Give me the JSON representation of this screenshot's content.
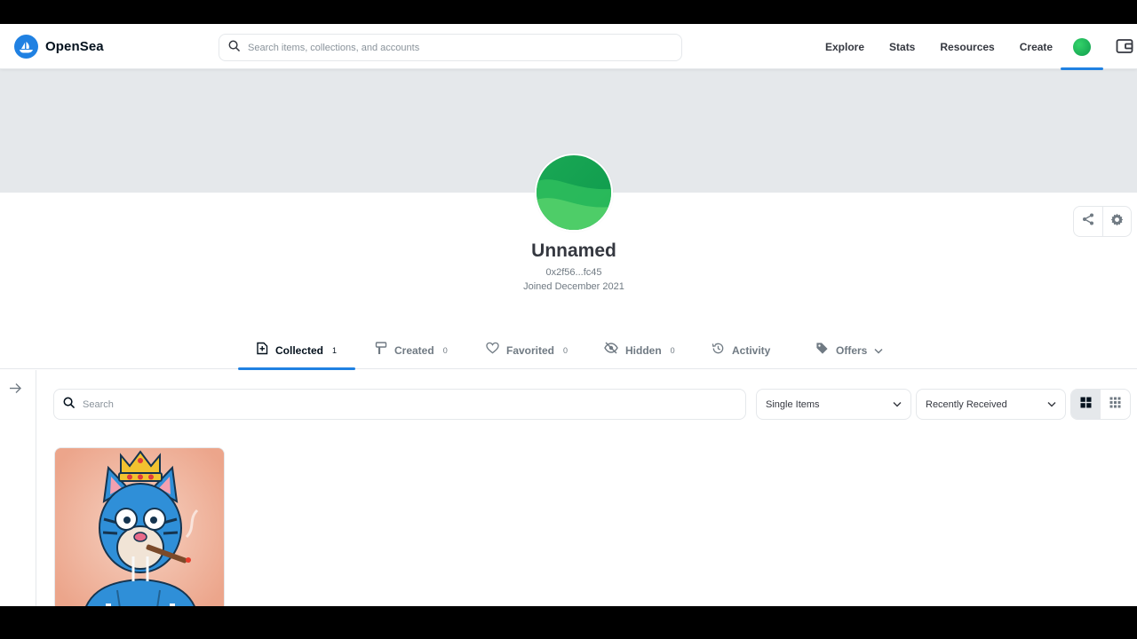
{
  "header": {
    "logo_text": "OpenSea",
    "search_placeholder": "Search items, collections, and accounts",
    "nav": [
      {
        "label": "Explore"
      },
      {
        "label": "Stats"
      },
      {
        "label": "Resources"
      },
      {
        "label": "Create"
      }
    ],
    "icons": [
      "opensea-logo-icon",
      "search-icon",
      "account-avatar-icon",
      "wallet-icon"
    ]
  },
  "profile": {
    "name": "Unnamed",
    "address": "0x2f56...fc45",
    "joined": "Joined December 2021",
    "avatar_colors": [
      "#18a957",
      "#5fd36f"
    ],
    "actions": [
      "share-icon",
      "settings-icon"
    ]
  },
  "tabs": [
    {
      "label": "Collected",
      "count": "1",
      "icon": "collected-icon",
      "active": true
    },
    {
      "label": "Created",
      "count": "0",
      "icon": "created-icon",
      "active": false
    },
    {
      "label": "Favorited",
      "count": "0",
      "icon": "heart-icon",
      "active": false
    },
    {
      "label": "Hidden",
      "count": "0",
      "icon": "eye-off-icon",
      "active": false
    },
    {
      "label": "Activity",
      "count": "",
      "icon": "history-icon",
      "active": false
    },
    {
      "label": "Offers",
      "count": "",
      "icon": "tag-icon",
      "active": false
    }
  ],
  "filters": {
    "search_placeholder": "Search",
    "item_type_selected": "Single Items",
    "sort_selected": "Recently Received",
    "view_modes": [
      {
        "icon": "large-grid-icon",
        "active": true
      },
      {
        "icon": "small-grid-icon",
        "active": false
      }
    ]
  },
  "items": [
    {
      "name": "nft-cat-king",
      "background": "#efa98f"
    }
  ],
  "colors": {
    "accent": "#2081e2",
    "banner": "#e5e8eb",
    "text_primary": "#04111d",
    "text_secondary": "#707a83"
  }
}
